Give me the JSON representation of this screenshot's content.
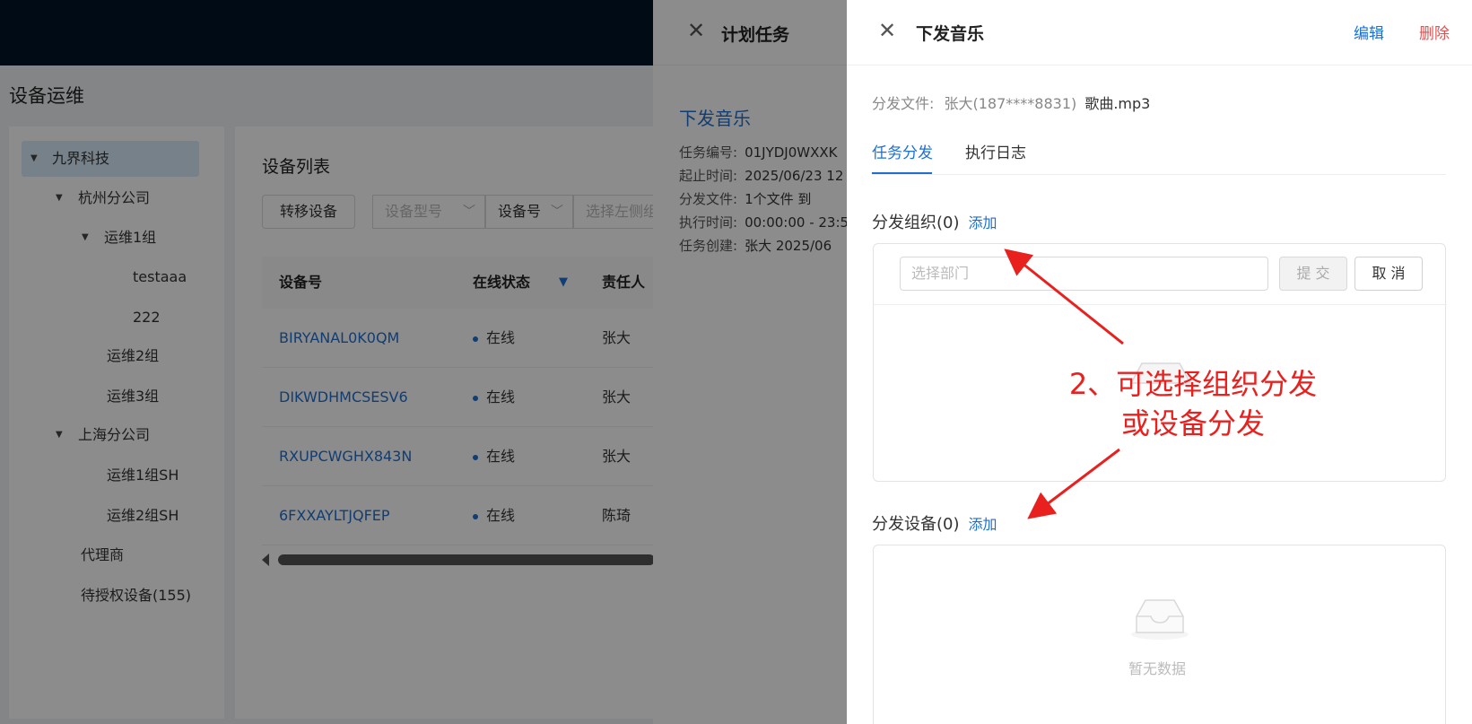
{
  "page": {
    "title": "设备运维",
    "tree": [
      {
        "label": "九界科技",
        "caret": true
      },
      {
        "label": "杭州分公司",
        "caret": true
      },
      {
        "label": "运维1组",
        "caret": true
      },
      {
        "label": "testaaa",
        "caret": false
      },
      {
        "label": "222",
        "caret": false
      },
      {
        "label": "运维2组",
        "caret": false
      },
      {
        "label": "运维3组",
        "caret": false
      },
      {
        "label": "上海分公司",
        "caret": true
      },
      {
        "label": "运维1组SH",
        "caret": false
      },
      {
        "label": "运维2组SH",
        "caret": false
      },
      {
        "label": "代理商",
        "caret": false
      },
      {
        "label": "待授权设备(155)",
        "caret": false
      }
    ],
    "device_list": {
      "title": "设备列表",
      "transfer_button": "转移设备",
      "filters": {
        "model_placeholder": "设备型号",
        "device_no": "设备号",
        "search_placeholder": "选择左侧组"
      },
      "columns": [
        "设备号",
        "在线状态",
        "责任人"
      ],
      "rows": [
        {
          "device": "BIRYANAL0K0QM",
          "status": "在线",
          "owner": "张大"
        },
        {
          "device": "DIKWDHMCSESV6",
          "status": "在线",
          "owner": "张大"
        },
        {
          "device": "RXUPCWGHX843N",
          "status": "在线",
          "owner": "张大"
        },
        {
          "device": "6FXXAYLTJQFEP",
          "status": "在线",
          "owner": "陈琦"
        }
      ]
    }
  },
  "plan_drawer": {
    "title": "计划任务",
    "task_name": "下发音乐",
    "info": [
      {
        "label": "任务编号:",
        "value": "01JYDJ0WXXK"
      },
      {
        "label": "起止时间:",
        "value": "2025/06/23 12"
      },
      {
        "label": "分发文件:",
        "value": "1个文件   到"
      },
      {
        "label": "执行时间:",
        "value": "00:00:00 - 23:5"
      },
      {
        "label": "任务创建:",
        "value": "张大   2025/06"
      }
    ]
  },
  "music_drawer": {
    "title": "下发音乐",
    "edit": "编辑",
    "delete": "删除",
    "file_label": "分发文件:",
    "file_value": "张大(187****8831) 歌曲.mp3",
    "file_name": "歌曲.mp3",
    "file_owner": "张大(187****8831)",
    "tabs": [
      "任务分发",
      "执行日志"
    ],
    "org_section": {
      "title": "分发组织(0)",
      "add": "添加"
    },
    "dept_placeholder": "选择部门",
    "submit": "提 交",
    "cancel": "取 消",
    "device_section": {
      "title": "分发设备(0)",
      "add": "添加"
    },
    "empty_text": "暂无数据"
  },
  "annotation": {
    "line1": "2、可选择组织分发",
    "line2": "或设备分发",
    "color": "#e8211f"
  },
  "colors": {
    "topbar": "#001529",
    "link": "#1f6fd2",
    "danger": "#e15252"
  }
}
